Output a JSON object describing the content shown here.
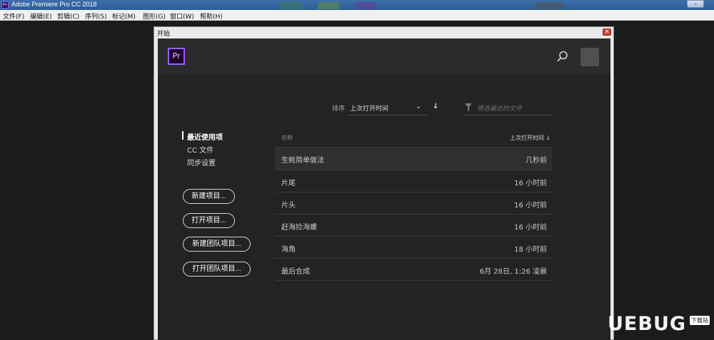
{
  "titlebar": {
    "app_icon": "Pr",
    "title": "Adobe Premiere Pro CC 2018"
  },
  "menu": [
    "文件(F)",
    "编辑(E)",
    "剪辑(C)",
    "序列(S)",
    "标记(M)",
    "图形(G)",
    "窗口(W)",
    "帮助(H)"
  ],
  "dialog": {
    "title": "开始",
    "close": "✕"
  },
  "header": {
    "logo": "Pr"
  },
  "nav": {
    "items": [
      {
        "label": "最近使用项",
        "active": true
      },
      {
        "label": "CC 文件",
        "active": false
      },
      {
        "label": "同步设置",
        "active": false
      }
    ]
  },
  "buttons": {
    "new_project": "新建项目...",
    "open_project": "打开项目...",
    "new_team_project": "新建团队项目...",
    "open_team_project": "打开团队项目..."
  },
  "sort": {
    "label": "排序",
    "value": "上次打开时间",
    "direction": "↓"
  },
  "filter": {
    "placeholder": "筛选最近的文件"
  },
  "table": {
    "col_name": "名称",
    "col_date": "上次打开时间 ↓",
    "rows": [
      {
        "name": "生蚝简单做法",
        "date": "几秒前"
      },
      {
        "name": "片尾",
        "date": "16 小时前"
      },
      {
        "name": "片头",
        "date": "16 小时前"
      },
      {
        "name": "赶海捡海螺",
        "date": "16 小时前"
      },
      {
        "name": "海角",
        "date": "18 小时前"
      },
      {
        "name": "最后合成",
        "date": "6月 28日, 1:26 凌晨"
      }
    ]
  },
  "watermark": {
    "text": "UEBUG",
    "sub": "下载站"
  },
  "colors": {
    "accent": "#9a5cff",
    "panel": "#232323",
    "header": "#2b2b2b"
  }
}
